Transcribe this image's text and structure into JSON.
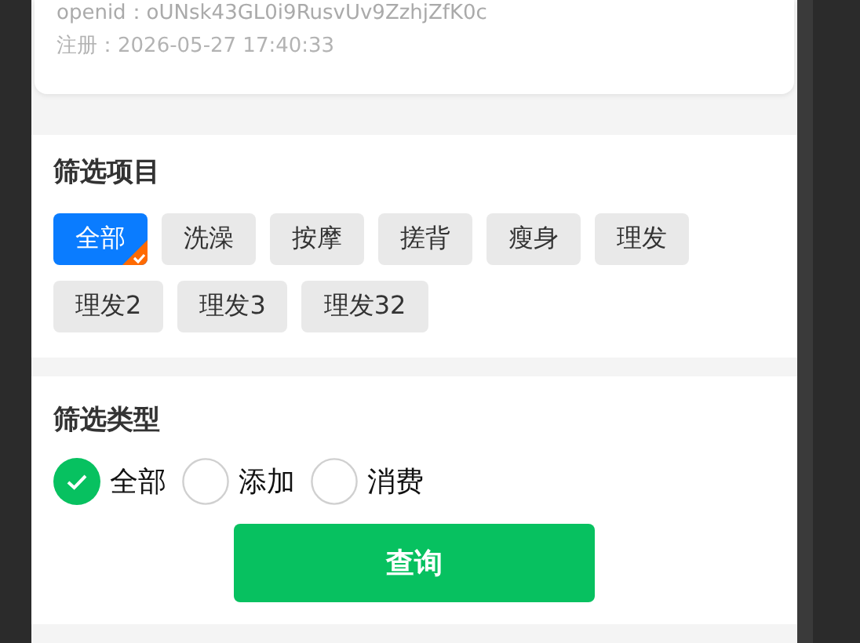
{
  "user_card": {
    "openid": "openid：oUNsk43GL0i9RusvUv9ZzhjZfK0c",
    "registered": "注册：2026-05-27 17:40:33"
  },
  "project_filter": {
    "title": "筛选项目",
    "items": [
      {
        "label": "全部",
        "selected": true
      },
      {
        "label": "洗澡",
        "selected": false
      },
      {
        "label": "按摩",
        "selected": false
      },
      {
        "label": "搓背",
        "selected": false
      },
      {
        "label": "瘦身",
        "selected": false
      },
      {
        "label": "理发",
        "selected": false
      },
      {
        "label": "理发2",
        "selected": false
      },
      {
        "label": "理发3",
        "selected": false
      },
      {
        "label": "理发32",
        "selected": false
      }
    ]
  },
  "type_filter": {
    "title": "筛选类型",
    "options": [
      {
        "label": "全部",
        "selected": true
      },
      {
        "label": "添加",
        "selected": false
      },
      {
        "label": "消费",
        "selected": false
      }
    ]
  },
  "query_button": "查询"
}
